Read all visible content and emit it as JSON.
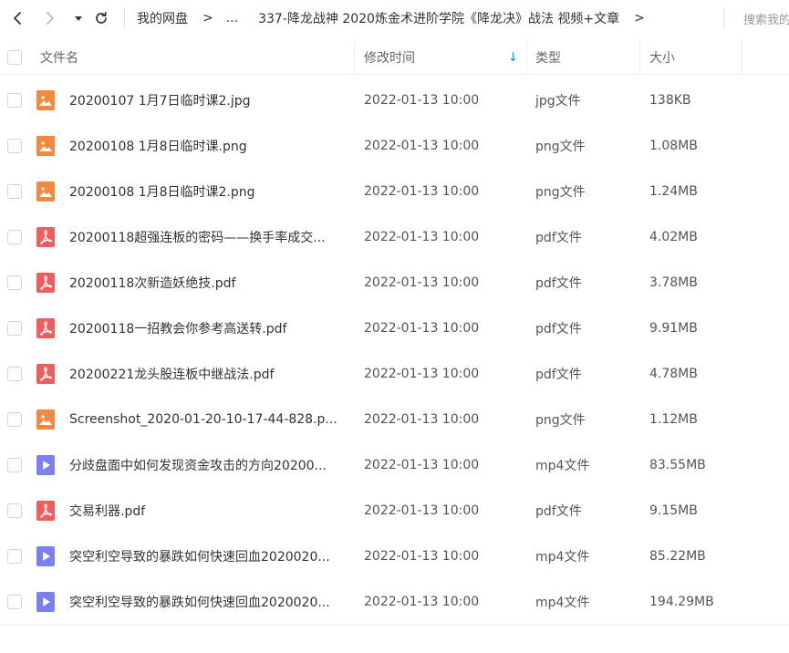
{
  "nav": {
    "back_label": "‹",
    "forward_label": "›",
    "dropdown_label": "▾",
    "refresh_label": "↻"
  },
  "breadcrumb": {
    "root": "我的网盘",
    "sep": ">",
    "ellipsis": "...",
    "current": "337-降龙战神 2020炼金术进阶学院《降龙决》战法 视频+文章"
  },
  "search": {
    "placeholder": "搜索我的"
  },
  "table": {
    "headers": {
      "name": "文件名",
      "modified": "修改时间",
      "sort_indicator": "↓",
      "type": "类型",
      "size": "大小"
    },
    "rows": [
      {
        "icon": "image-file-icon",
        "name": "20200107  1月7日临时课2.jpg",
        "modified": "2022-01-13 10:00",
        "type": "jpg文件",
        "size": "138KB"
      },
      {
        "icon": "image-file-icon",
        "name": "20200108  1月8日临时课.png",
        "modified": "2022-01-13 10:00",
        "type": "png文件",
        "size": "1.08MB"
      },
      {
        "icon": "image-file-icon",
        "name": "20200108  1月8日临时课2.png",
        "modified": "2022-01-13 10:00",
        "type": "png文件",
        "size": "1.24MB"
      },
      {
        "icon": "pdf-file-icon",
        "name": "20200118超强连板的密码——换手率成交...",
        "modified": "2022-01-13 10:00",
        "type": "pdf文件",
        "size": "4.02MB"
      },
      {
        "icon": "pdf-file-icon",
        "name": "20200118次新造妖绝技.pdf",
        "modified": "2022-01-13 10:00",
        "type": "pdf文件",
        "size": "3.78MB"
      },
      {
        "icon": "pdf-file-icon",
        "name": "20200118一招教会你参考高送转.pdf",
        "modified": "2022-01-13 10:00",
        "type": "pdf文件",
        "size": "9.91MB"
      },
      {
        "icon": "pdf-file-icon",
        "name": "20200221龙头股连板中继战法.pdf",
        "modified": "2022-01-13 10:00",
        "type": "pdf文件",
        "size": "4.78MB"
      },
      {
        "icon": "image-file-icon",
        "name": "Screenshot_2020-01-20-10-17-44-828.p...",
        "modified": "2022-01-13 10:00",
        "type": "png文件",
        "size": "1.12MB"
      },
      {
        "icon": "video-file-icon",
        "name": "分歧盘面中如何发现资金攻击的方向20200...",
        "modified": "2022-01-13 10:00",
        "type": "mp4文件",
        "size": "83.55MB"
      },
      {
        "icon": "pdf-file-icon",
        "name": "交易利器.pdf",
        "modified": "2022-01-13 10:00",
        "type": "pdf文件",
        "size": "9.15MB"
      },
      {
        "icon": "video-file-icon",
        "name": "突空利空导致的暴跌如何快速回血2020020...",
        "modified": "2022-01-13 10:00",
        "type": "mp4文件",
        "size": "85.22MB"
      },
      {
        "icon": "video-file-icon",
        "name": "突空利空导致的暴跌如何快速回血2020020...",
        "modified": "2022-01-13 10:00",
        "type": "mp4文件",
        "size": "194.29MB"
      }
    ]
  },
  "colors": {
    "image_icon": "#f6883e",
    "pdf_icon": "#f25c5c",
    "video_icon": "#7b7ff2",
    "sort_arrow": "#1e88e5"
  }
}
